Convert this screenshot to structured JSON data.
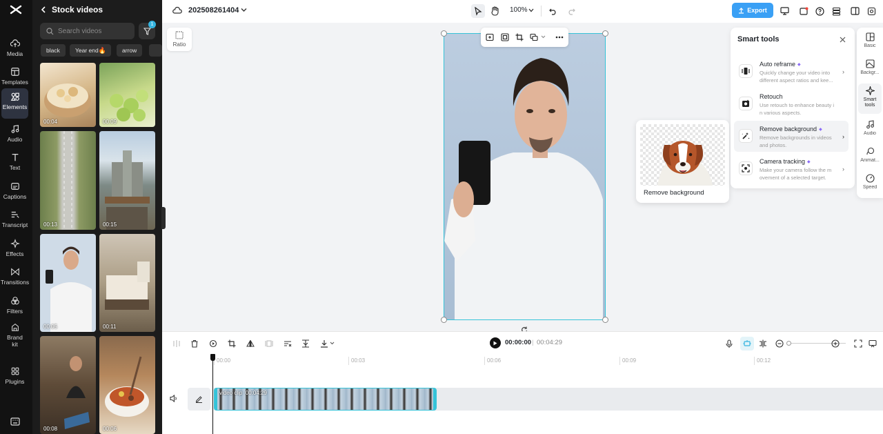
{
  "nav": {
    "items": [
      {
        "label": "Media",
        "icon": "cloud-upload-icon"
      },
      {
        "label": "Templates",
        "icon": "templates-icon"
      },
      {
        "label": "Elements",
        "icon": "elements-icon"
      },
      {
        "label": "Audio",
        "icon": "music-note-icon"
      },
      {
        "label": "Text",
        "icon": "text-icon"
      },
      {
        "label": "Captions",
        "icon": "captions-icon"
      },
      {
        "label": "Transcript",
        "icon": "transcript-icon"
      },
      {
        "label": "Effects",
        "icon": "effects-icon"
      },
      {
        "label": "Transitions",
        "icon": "transitions-icon"
      },
      {
        "label": "Filters",
        "icon": "filters-icon"
      },
      {
        "label": "Brand kit",
        "icon": "brand-kit-icon"
      },
      {
        "label": "Plugins",
        "icon": "plugins-icon"
      }
    ],
    "active": "Elements"
  },
  "panel": {
    "title": "Stock videos",
    "search_placeholder": "Search videos",
    "filter_count": "1",
    "tags": [
      "black",
      "Year end",
      "arrow"
    ],
    "thumbs": [
      {
        "duration": "00:04"
      },
      {
        "duration": "00:09"
      },
      {
        "duration": "00:13"
      },
      {
        "duration": "00:15"
      },
      {
        "duration": "00:05"
      },
      {
        "duration": "00:11"
      },
      {
        "duration": "00:08"
      },
      {
        "duration": "00:06"
      }
    ]
  },
  "topbar": {
    "project_name": "202508261404",
    "zoom": "100%",
    "export_label": "Export"
  },
  "canvas": {
    "ratio_label": "Ratio"
  },
  "preview": {
    "label": "Remove background"
  },
  "smart_tools": {
    "title": "Smart tools",
    "tools": [
      {
        "name": "Auto reframe",
        "desc": "Quickly change your video into different aspect ratios and kee...",
        "pro": true
      },
      {
        "name": "Retouch",
        "desc": "Use retouch to enhance beauty i n various aspects.",
        "pro": false
      },
      {
        "name": "Remove background",
        "desc": "Remove backgrounds in videos and photos.",
        "pro": true
      },
      {
        "name": "Camera tracking",
        "desc": "Make your camera follow the m ovement of a selected target.",
        "pro": true
      }
    ]
  },
  "rail": {
    "items": [
      {
        "label": "Basic"
      },
      {
        "label": "Backgr..."
      },
      {
        "label": "Smart tools"
      },
      {
        "label": "Audio"
      },
      {
        "label": "Animat..."
      },
      {
        "label": "Speed"
      }
    ]
  },
  "timeline": {
    "current_time": "00:00:00",
    "total_time": "00:04:29",
    "ruler": [
      "00:00",
      "00:03",
      "00:06",
      "00:09",
      "00:12"
    ],
    "clip_label": "video clip",
    "clip_duration": "00:04:29"
  },
  "colors": {
    "accent": "#35c3d8",
    "export": "#3aa0f5",
    "pro": "#8b6cf7"
  }
}
